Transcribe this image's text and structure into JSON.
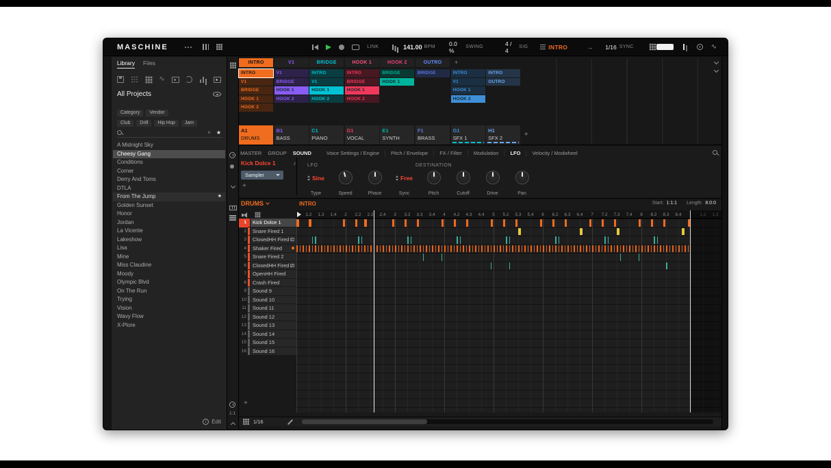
{
  "icons": {
    "star": "★",
    "note": "♪",
    "wave": "∿",
    "arrow": "→",
    "plus": "+",
    "clear": "×",
    "info": "i"
  },
  "header": {
    "logo": "MASCHINE",
    "transport": {
      "link": "LINK"
    },
    "tempo": {
      "value": "141.00",
      "label": "BPM"
    },
    "swing": {
      "value": "0.0 %",
      "label": "SWING"
    },
    "signature": {
      "value": "4 / 4",
      "label": "SIG"
    },
    "section_display": "INTRO",
    "follow_grid": {
      "value": "1/16",
      "label": "SYNC"
    }
  },
  "library": {
    "tabs": [
      {
        "label": "Library",
        "active": true
      },
      {
        "label": "Files",
        "active": false
      }
    ],
    "title": "All Projects",
    "filter_tags_row1": [
      "Category",
      "Vendor"
    ],
    "filter_tags_row2": [
      "Club",
      "Drill",
      "Hip Hop",
      "Jam"
    ],
    "projects": [
      {
        "name": "A Midnight Sky"
      },
      {
        "name": "Cheesy Gang",
        "selected": true
      },
      {
        "name": "Conditions"
      },
      {
        "name": "Corner"
      },
      {
        "name": "Derry And Toms"
      },
      {
        "name": "DTLA"
      },
      {
        "name": "From The Jump",
        "starred": true,
        "highlight": true
      },
      {
        "name": "Golden Sunset"
      },
      {
        "name": "Honor"
      },
      {
        "name": "Jordan"
      },
      {
        "name": "La Vicente"
      },
      {
        "name": "Lakeshow"
      },
      {
        "name": "Lisa"
      },
      {
        "name": "Mine"
      },
      {
        "name": "Miss Claudine"
      },
      {
        "name": "Moody"
      },
      {
        "name": "Olympic Blvd"
      },
      {
        "name": "On The Run"
      },
      {
        "name": "Trying"
      },
      {
        "name": "Vision"
      },
      {
        "name": "Wavy Flow"
      },
      {
        "name": "X-Plore"
      }
    ],
    "edit_label": "Edit"
  },
  "arranger": {
    "sections": [
      {
        "name": "INTRO",
        "color": "#f06c1e",
        "active": true
      },
      {
        "name": "V1",
        "color": "#8a5cf5"
      },
      {
        "name": "BRIDGE",
        "color": "#00c3d4"
      },
      {
        "name": "HOOK 1",
        "color": "#ff4d7e"
      },
      {
        "name": "HOOK 2",
        "color": "#e8417e"
      },
      {
        "name": "OUTRO",
        "color": "#5f8dff"
      }
    ],
    "groups": [
      {
        "id": "A1",
        "name": "DRUMS",
        "color": "#f06c1e",
        "selected": true
      },
      {
        "id": "B1",
        "name": "BASS",
        "color": "#8a5cf5"
      },
      {
        "id": "C1",
        "name": "PIANO",
        "color": "#00c3d4"
      },
      {
        "id": "D1",
        "name": "VOCAL",
        "color": "#f0385c"
      },
      {
        "id": "E1",
        "name": "SYNTH",
        "color": "#00b39b"
      },
      {
        "id": "F1",
        "name": "BRASS",
        "color": "#5a78e0"
      },
      {
        "id": "G1",
        "name": "SFX 1",
        "color": "#3f8fd8",
        "strip": "#00c3d4"
      },
      {
        "id": "H1",
        "name": "SFX 2",
        "color": "#6aa8f0",
        "strip": "#6aa8f0"
      }
    ],
    "clip_columns": [
      {
        "clips": [
          {
            "name": "INTRO",
            "state": "selected"
          },
          {
            "name": "V1"
          },
          {
            "name": "BRIDGE"
          },
          {
            "name": "HOOK 1"
          },
          {
            "name": "HOOK 2"
          }
        ]
      },
      {
        "clips": [
          {
            "name": "V1"
          },
          {
            "name": "BRIDGE"
          },
          {
            "name": "HOOK 1",
            "state": "bright"
          },
          {
            "name": "HOOK 2"
          }
        ]
      },
      {
        "clips": [
          {
            "name": "INTRO"
          },
          {
            "name": "V1"
          },
          {
            "name": "HOOK 1",
            "state": "bright"
          },
          {
            "name": "HOOK 2"
          }
        ]
      },
      {
        "clips": [
          {
            "name": "INTRO"
          },
          {
            "name": "BRIDGE"
          },
          {
            "name": "HOOK 1",
            "state": "bright"
          },
          {
            "name": "HOOK 2"
          }
        ]
      },
      {
        "clips": [
          {
            "name": "BRIDGE"
          },
          {
            "name": "HOOK 1",
            "state": "bright"
          }
        ]
      },
      {
        "clips": [
          {
            "name": "BRIDGE"
          }
        ]
      },
      {
        "clips": [
          {
            "name": "INTRO"
          },
          {
            "name": "V1"
          },
          {
            "name": "HOOK 1"
          },
          {
            "name": "HOOK 2",
            "state": "bright"
          }
        ]
      },
      {
        "clips": [
          {
            "name": "INTRO"
          },
          {
            "name": "OUTRO"
          }
        ]
      }
    ]
  },
  "control": {
    "scope_tabs": [
      {
        "label": "MASTER"
      },
      {
        "label": "GROUP"
      },
      {
        "label": "SOUND",
        "active": true
      }
    ],
    "param_tabs": [
      {
        "label": "Voice Settings / Engine"
      },
      {
        "label": "Pitch / Envelope"
      },
      {
        "label": "FX / Filter"
      },
      {
        "label": "Modulation"
      },
      {
        "label": "LFO",
        "active": true
      },
      {
        "label": "Velocity / Modwheel"
      }
    ],
    "sound_name": "Kick Dolce 1",
    "plugin": "Sampler",
    "section_label": "LFO",
    "destination_label": "DESTINATION",
    "params": [
      {
        "kind": "enum",
        "value": "Sine",
        "label": "Type"
      },
      {
        "kind": "knob",
        "label": "Speed",
        "angle": -15
      },
      {
        "kind": "knob",
        "label": "Phase",
        "angle": 0
      },
      {
        "kind": "enum",
        "value": "Free",
        "label": "Sync"
      },
      {
        "kind": "knob",
        "label": "Pitch",
        "angle": 0
      },
      {
        "kind": "knob",
        "label": "Cutoff",
        "angle": 0
      },
      {
        "kind": "knob",
        "label": "Drive",
        "angle": 0
      },
      {
        "kind": "knob",
        "label": "Pan",
        "angle": 0
      }
    ]
  },
  "pattern": {
    "group_label": "DRUMS",
    "pattern_label": "INTRO",
    "start_label": "Start:",
    "start_value": "1:1:1",
    "length_label": "Length:",
    "length_value": "8:0:0",
    "grid_label": "1/16",
    "position_label": "1:1",
    "ruler_labels": [
      "1.2",
      "1.3",
      "1.4",
      "2",
      "2.2",
      "2.3",
      "2.4",
      "3",
      "3.2",
      "3.3",
      "3.4",
      "4",
      "4.2",
      "4.3",
      "4.4",
      "5",
      "5.2",
      "5.3",
      "5.4",
      "6",
      "6.2",
      "6.3",
      "6.4",
      "7",
      "7.2",
      "7.3",
      "7.4",
      "8",
      "8.2",
      "8.3",
      "8.4"
    ],
    "next_ruler_labels": [
      "1.2",
      "1.3"
    ],
    "sounds": [
      {
        "num": "1",
        "name": "Kick Dolce 1",
        "color": "#e8452c",
        "selected": true
      },
      {
        "num": "2",
        "name": "Snare Fired 1",
        "color": "#e8542c"
      },
      {
        "num": "3",
        "name": "ClosedHH Fired 1",
        "color": "#e8542c",
        "icon": true
      },
      {
        "num": "4",
        "name": "Shaker Fired",
        "color": "#e8542c",
        "dot": true
      },
      {
        "num": "5",
        "name": "Snare Fired 2",
        "color": "#e8542c"
      },
      {
        "num": "6",
        "name": "ClosedHH Fired 2",
        "color": "#e8542c",
        "icon": true
      },
      {
        "num": "7",
        "name": "OpenHH Fired",
        "color": "#e8542c"
      },
      {
        "num": "8",
        "name": "Crash Fired",
        "color": "#e8542c"
      },
      {
        "num": "9",
        "name": "Sound 9",
        "color": "#5f5f5f"
      },
      {
        "num": "10",
        "name": "Sound 10",
        "color": "#5f5f5f"
      },
      {
        "num": "11",
        "name": "Sound 11",
        "color": "#5f5f5f"
      },
      {
        "num": "12",
        "name": "Sound 12",
        "color": "#5f5f5f"
      },
      {
        "num": "13",
        "name": "Sound 13",
        "color": "#5f5f5f"
      },
      {
        "num": "14",
        "name": "Sound 14",
        "color": "#5f5f5f"
      },
      {
        "num": "15",
        "name": "Sound 15",
        "color": "#5f5f5f"
      },
      {
        "num": "16",
        "name": "Sound 16",
        "color": "#5f5f5f"
      }
    ],
    "notes": [
      {
        "row": 0,
        "color": "#f06c1e",
        "w": 1.1,
        "steps": [
          0,
          4,
          15,
          19,
          22,
          31,
          35,
          39,
          47,
          51,
          55,
          63,
          67,
          71,
          79,
          83,
          87,
          95,
          99,
          103,
          111,
          115,
          119,
          127
        ]
      },
      {
        "row": 1,
        "color": "#e3c93e",
        "w": 1.2,
        "steps": [
          72,
          92,
          104,
          125
        ]
      },
      {
        "row": 2,
        "color": "#3fae9e",
        "w": 0.5,
        "steps": [
          5,
          6,
          20,
          21,
          36,
          37,
          52,
          53,
          68,
          69,
          84,
          85,
          100,
          101,
          116,
          117
        ]
      },
      {
        "row": 3,
        "color": "#e8641b",
        "w": 0.5,
        "range": [
          0,
          127
        ]
      },
      {
        "row": 4,
        "color": "#3fae9e",
        "w": 0.5,
        "steps": [
          41,
          47,
          105,
          111
        ]
      },
      {
        "row": 5,
        "color": "#3fae9e",
        "w": 0.5,
        "steps": [
          25,
          63,
          69,
          120
        ]
      }
    ],
    "playhead_step": 25,
    "pattern_end_step": 128
  }
}
